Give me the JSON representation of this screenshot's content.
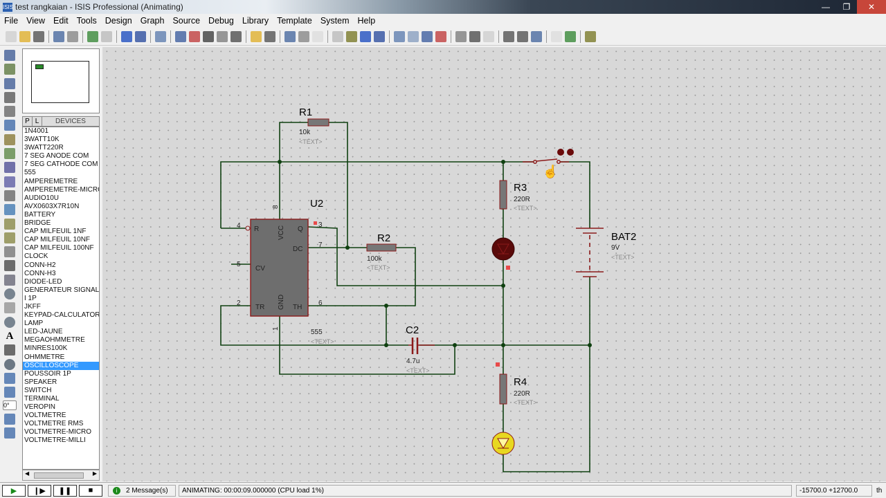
{
  "window": {
    "title": "test rangkaian - ISIS Professional (Animating)",
    "app_icon": "ISIS"
  },
  "menu": [
    "File",
    "View",
    "Edit",
    "Tools",
    "Design",
    "Graph",
    "Source",
    "Debug",
    "Library",
    "Template",
    "System",
    "Help"
  ],
  "device_panel": {
    "tab_p": "P",
    "tab_l": "L",
    "header": "DEVICES",
    "items": [
      "1N4001",
      "3WATT10K",
      "3WATT220R",
      "7 SEG ANODE COM",
      "7 SEG CATHODE COM",
      "555",
      "AMPEREMETRE",
      "AMPEREMETRE-MICRO",
      "AUDIO10U",
      "AVX0603X7R10N",
      "BATTERY",
      "BRIDGE",
      "CAP MILFEUIL 1NF",
      "CAP MILFEUIL 10NF",
      "CAP MILFEUIL 100NF",
      "CLOCK",
      "CONN-H2",
      "CONN-H3",
      "DIODE-LED",
      "GENERATEUR SIGNAL",
      "I 1P",
      "JKFF",
      "KEYPAD-CALCULATOR",
      "LAMP",
      "LED-JAUNE",
      "MEGAOHMMETRE",
      "MINRES100K",
      "OHMMETRE",
      "OSCILLOSCOPE",
      "POUSSOIR 1P",
      "SPEAKER",
      "SWITCH",
      "TERMINAL",
      "VEROPIN",
      "VOLTMETRE",
      "VOLTMETRE RMS",
      "VOLTMETRE-MICRO",
      "VOLTMETRE-MILLI"
    ],
    "selected": "OSCILLOSCOPE"
  },
  "rotation": "0°",
  "schematic": {
    "r1": {
      "ref": "R1",
      "value": "10k",
      "text": "<TEXT>"
    },
    "u2": {
      "ref": "U2",
      "value": "555",
      "text": "<TEXT>",
      "pins": {
        "r": "R",
        "vcc": "VCC",
        "q": "Q",
        "dc": "DC",
        "cv": "CV",
        "tr": "TR",
        "gnd": "GND",
        "th": "TH",
        "p4": "4",
        "p5": "5",
        "p2": "2",
        "p3": "3",
        "p7": "7",
        "p6": "6",
        "p8": "8",
        "p1": "1"
      }
    },
    "r2": {
      "ref": "R2",
      "value": "100k",
      "text": "<TEXT>"
    },
    "c2": {
      "ref": "C2",
      "value": "4.7u",
      "text": "<TEXT>"
    },
    "r3": {
      "ref": "R3",
      "value": "220R",
      "text": "<TEXT>"
    },
    "bat2": {
      "ref": "BAT2",
      "value": "9V",
      "text": "<TEXT>"
    },
    "r4": {
      "ref": "R4",
      "value": "220R",
      "text": "<TEXT>"
    },
    "led_top_color": "#5a0a0a",
    "led_bottom_color": "#e8d820",
    "wire_color": "#0f4010",
    "component_outline": "#8b1a1a"
  },
  "status": {
    "messages": "2 Message(s)",
    "animating": "ANIMATING: 00:00:09.000000 (CPU load 1%)",
    "coords": "-15700.0 +12700.0",
    "unit": "th"
  }
}
